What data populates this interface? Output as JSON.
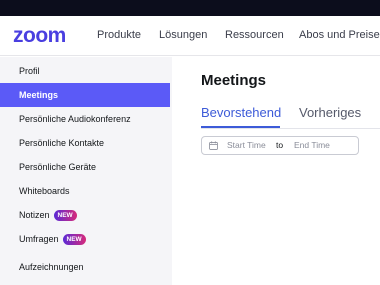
{
  "brand": {
    "logo_text": "zoom",
    "color": "#4a3fe0"
  },
  "topnav": {
    "items": [
      {
        "label": "Produkte"
      },
      {
        "label": "Lösungen"
      },
      {
        "label": "Ressourcen"
      },
      {
        "label": "Abos und Preise"
      }
    ]
  },
  "sidebar": {
    "active_color": "#5b5af7",
    "items": [
      {
        "label": "Profil"
      },
      {
        "label": "Meetings",
        "active": true
      },
      {
        "label": "Persönliche Audiokonferenz"
      },
      {
        "label": "Persönliche Kontakte"
      },
      {
        "label": "Persönliche Geräte"
      },
      {
        "label": "Whiteboards"
      },
      {
        "label": "Notizen",
        "badge": "NEW"
      },
      {
        "label": "Umfragen",
        "badge": "NEW"
      },
      {
        "label": "Aufzeichnungen"
      }
    ]
  },
  "main": {
    "title": "Meetings",
    "tabs": [
      {
        "label": "Bevorstehend",
        "active": true
      },
      {
        "label": "Vorheriges"
      }
    ],
    "date_range": {
      "icon": "calendar-icon",
      "start_placeholder": "Start Time",
      "separator": "to",
      "end_placeholder": "End Time"
    }
  }
}
